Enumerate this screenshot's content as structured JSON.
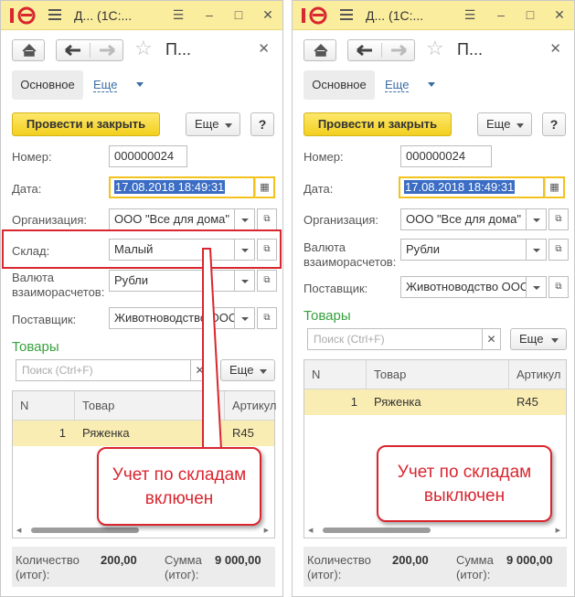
{
  "panels": [
    {
      "title": "Д...  (1С:...",
      "form_title": "П...",
      "tabs": {
        "main": "Основное",
        "more": "Еще"
      },
      "post_button": "Провести и закрыть",
      "more_button": "Еще",
      "help_button": "?",
      "fields": {
        "number": {
          "label": "Номер:",
          "value": "000000024"
        },
        "date": {
          "label": "Дата:",
          "value": "17.08.2018 18:49:31"
        },
        "organization": {
          "label": "Организация:",
          "value": "ООО \"Все для дома\""
        },
        "warehouse": {
          "label": "Склад:",
          "value": "Малый"
        },
        "currency": {
          "label_line1": "Валюта",
          "label_line2": "взаиморасчетов:",
          "value": "Рубли"
        },
        "supplier": {
          "label": "Поставщик:",
          "value": "Животноводство ООО"
        }
      },
      "goods_section": "Товары",
      "search_placeholder": "Поиск (Ctrl+F)",
      "table": {
        "columns": [
          "N",
          "Товар",
          "Артикул"
        ],
        "rows": [
          {
            "n": "1",
            "product": "Ряженка",
            "article": "R45"
          }
        ]
      },
      "footer": {
        "qty_label_1": "Количество",
        "qty_label_2": "(итог):",
        "qty_value": "200,00",
        "sum_label_1": "Сумма",
        "sum_label_2": "(итог):",
        "sum_value": "9 000,00"
      },
      "callout": {
        "line1": "Учет по складам",
        "line2": "включен"
      }
    },
    {
      "title": "Д...  (1С:...",
      "form_title": "П...",
      "tabs": {
        "main": "Основное",
        "more": "Еще"
      },
      "post_button": "Провести и закрыть",
      "more_button": "Еще",
      "help_button": "?",
      "fields": {
        "number": {
          "label": "Номер:",
          "value": "000000024"
        },
        "date": {
          "label": "Дата:",
          "value": "17.08.2018 18:49:31"
        },
        "organization": {
          "label": "Организация:",
          "value": "ООО \"Все для дома\""
        },
        "currency": {
          "label_line1": "Валюта",
          "label_line2": "взаиморасчетов:",
          "value": "Рубли"
        },
        "supplier": {
          "label": "Поставщик:",
          "value": "Животноводство ООО"
        }
      },
      "goods_section": "Товары",
      "search_placeholder": "Поиск (Ctrl+F)",
      "table": {
        "columns": [
          "N",
          "Товар",
          "Артикул"
        ],
        "rows": [
          {
            "n": "1",
            "product": "Ряженка",
            "article": "R45"
          }
        ]
      },
      "footer": {
        "qty_label_1": "Количество",
        "qty_label_2": "(итог):",
        "qty_value": "200,00",
        "sum_label_1": "Сумма",
        "sum_label_2": "(итог):",
        "sum_value": "9 000,00"
      },
      "callout": {
        "line1": "Учет по складам",
        "line2": "выключен"
      }
    }
  ],
  "colors": {
    "accent": "#fbed9e",
    "post_button": "#f3cf1e",
    "section": "#36a13d",
    "callout": "#d9262f",
    "row_selected": "#faedb3"
  }
}
